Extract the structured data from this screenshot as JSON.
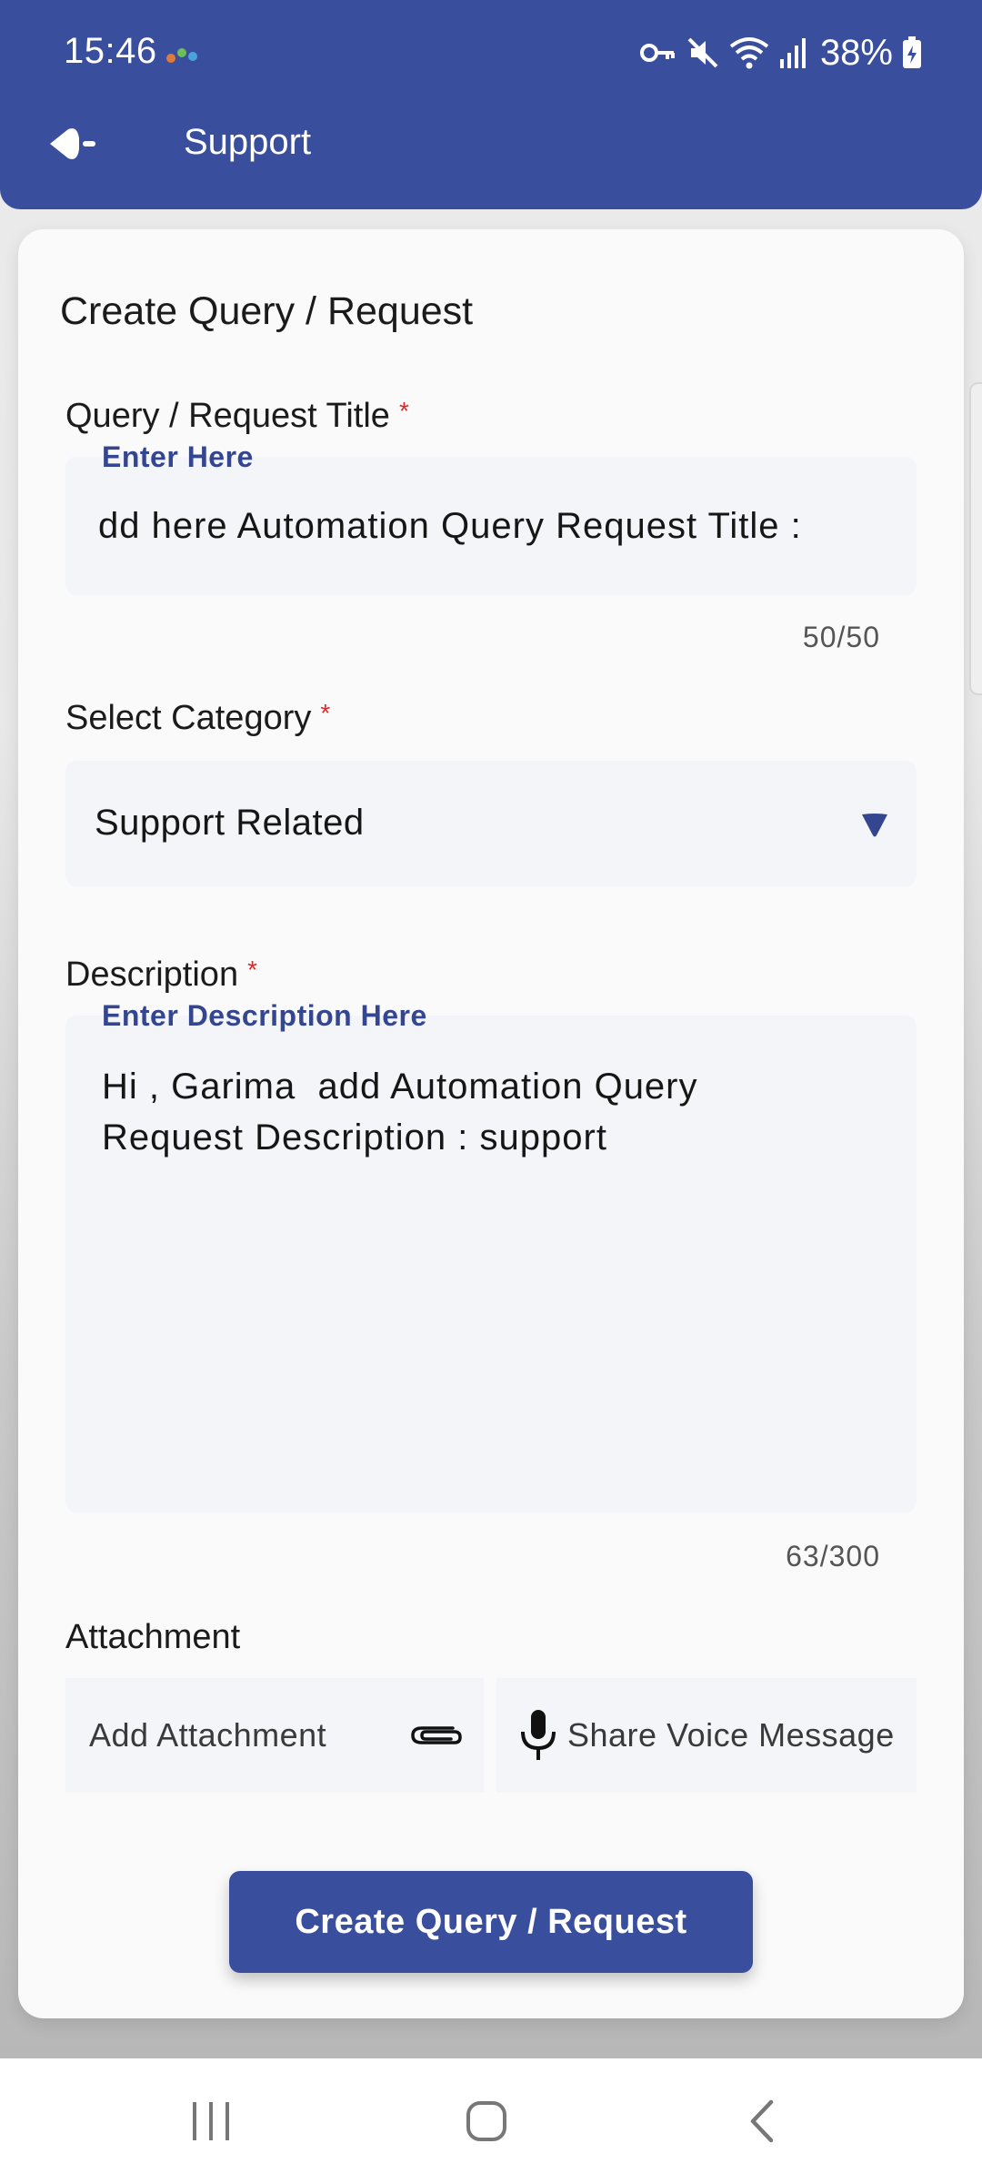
{
  "status_bar": {
    "time": "15:46",
    "battery_percent": "38%"
  },
  "header": {
    "title": "Support",
    "back_icon": "back-arrow-icon"
  },
  "form": {
    "title": "Create Query / Request",
    "title_field": {
      "label": "Query / Request Title",
      "required_mark": "*",
      "floating_label": "Enter Here",
      "value": "dd here Automation Query Request Title :",
      "counter": "50/50"
    },
    "category_field": {
      "label": "Select Category",
      "required_mark": "*",
      "selected": "Support Related"
    },
    "description_field": {
      "label": "Description",
      "required_mark": "*",
      "floating_label": "Enter Description Here",
      "value": "Hi , Garima  add Automation Query\nRequest Description : support",
      "counter": "63/300"
    },
    "attachment": {
      "label": "Attachment",
      "add_label": "Add Attachment",
      "voice_label": "Share Voice Message"
    },
    "submit_label": "Create Query / Request"
  },
  "colors": {
    "primary": "#3a4e9e",
    "required": "#d32f2f",
    "input_bg": "#f3f5f9"
  }
}
